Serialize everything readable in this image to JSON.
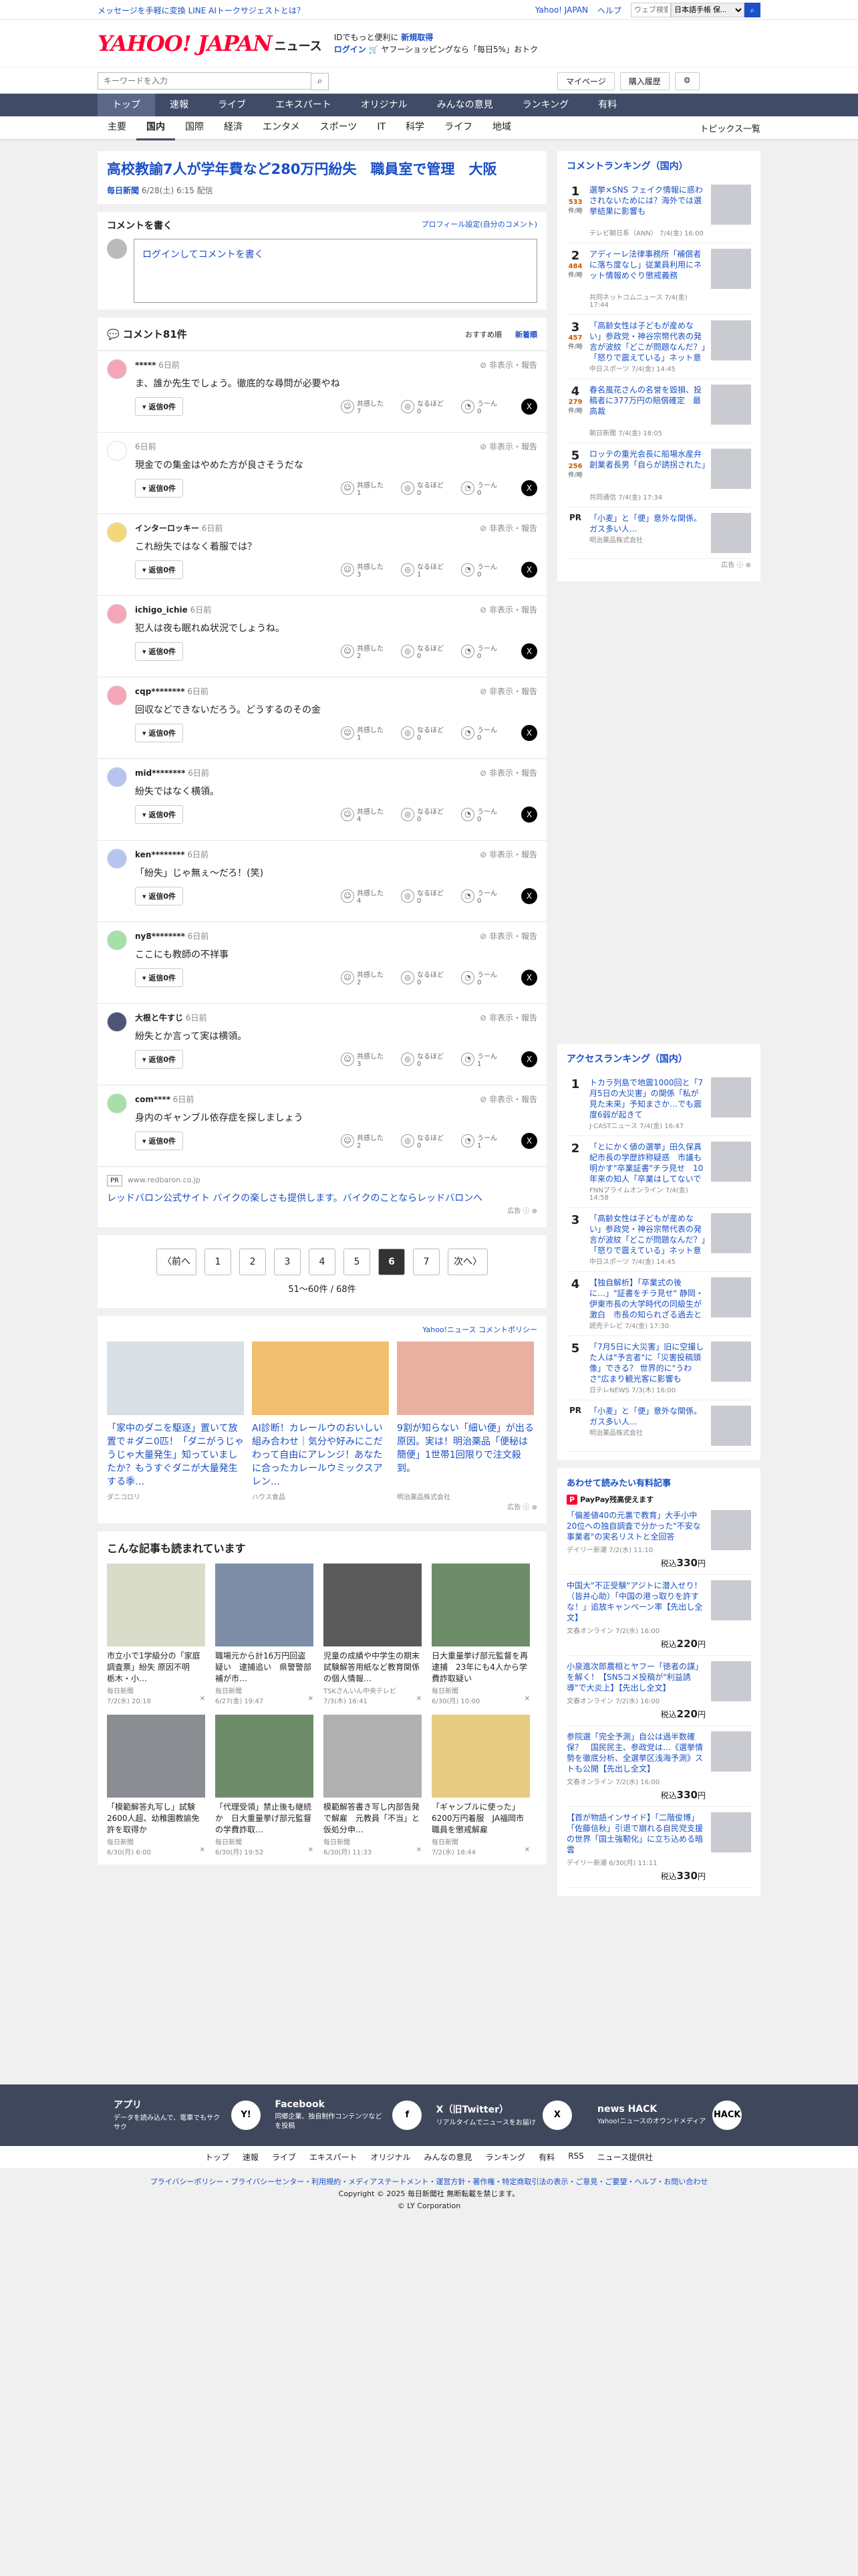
{
  "topbar": {
    "promo": "メッセージを手軽に変換 LINE AIトークサジェストとは？",
    "links": [
      "Yahoo! JAPAN",
      "ヘルプ"
    ],
    "search_placeholder": "ウェブ検索",
    "search_scope": "日本語手帳 保..."
  },
  "header": {
    "logo": "YAHOO! JAPAN",
    "logo_sub": "ニュース",
    "promo_line1": "IDでもっと便利に",
    "promo_new": "新規取得",
    "promo_login": "ログイン",
    "promo_line2": "ヤフーショッピングなら「毎日5%」おトク"
  },
  "search": {
    "placeholder": "キーワードを入力",
    "mypage": "マイページ",
    "purchased": "購入履歴"
  },
  "nav1": [
    "トップ",
    "速報",
    "ライブ",
    "エキスパート",
    "オリジナル",
    "みんなの意見",
    "ランキング",
    "有料"
  ],
  "nav2": [
    "主要",
    "国内",
    "国際",
    "経済",
    "エンタメ",
    "スポーツ",
    "IT",
    "科学",
    "ライフ",
    "地域"
  ],
  "nav2_topics": "トピックス一覧",
  "article": {
    "title": "高校教諭7人が学年費など280万円紛失　職員室で管理　大阪",
    "source": "毎日新聞",
    "date": "6/28(土) 6:15 配信"
  },
  "cwrite": {
    "heading": "コメントを書く",
    "profile": "プロフィール設定(自分のコメント)",
    "placeholder": "ログインしてコメントを書く"
  },
  "comments": {
    "count_label": "コメント81件",
    "sort": [
      "おすすめ順",
      "新着順"
    ],
    "reply": "返信0件",
    "report": "非表示・報告",
    "sympathy": "共感した",
    "hmm": "なるほど",
    "umm": "うーん",
    "items": [
      {
        "name": "*****",
        "time": "6日前",
        "text": "ま、誰か先生でしょう。徹底的な尋問が必要やね",
        "s": "7",
        "n": "0",
        "u": "0",
        "color": "#f4a6b8"
      },
      {
        "name": "",
        "time": "6日前",
        "text": "現金での集金はやめた方が良さそうだな",
        "s": "1",
        "n": "0",
        "u": "0",
        "color": "#ffffff"
      },
      {
        "name": "インターロッキー",
        "time": "6日前",
        "text": "これ紛失ではなく着服では？",
        "s": "3",
        "n": "1",
        "u": "0",
        "color": "#f5d77a"
      },
      {
        "name": "ichigo_ichie",
        "time": "6日前",
        "text": "犯人は夜も眠れぬ状況でしょうね。",
        "s": "2",
        "n": "0",
        "u": "0",
        "color": "#f4a6b8"
      },
      {
        "name": "cqp********",
        "time": "6日前",
        "text": "回収などできないだろう。どうするのその金",
        "s": "1",
        "n": "0",
        "u": "0",
        "color": "#f4a6b8"
      },
      {
        "name": "mid********",
        "time": "6日前",
        "text": "紛失ではなく横領。",
        "s": "4",
        "n": "0",
        "u": "0",
        "color": "#b8c4f0"
      },
      {
        "name": "ken********",
        "time": "6日前",
        "text": "「紛失」じゃ無ぇ〜だろ！(笑)",
        "s": "4",
        "n": "0",
        "u": "0",
        "color": "#b8c4f0"
      },
      {
        "name": "ny8********",
        "time": "6日前",
        "text": "ここにも教師の不祥事",
        "s": "2",
        "n": "0",
        "u": "0",
        "color": "#a6e0a8"
      },
      {
        "name": "大根と牛すじ",
        "time": "6日前",
        "text": "紛失とか言って実は横領。",
        "s": "3",
        "n": "0",
        "u": "1",
        "color": "#4a5577"
      },
      {
        "name": "com****",
        "time": "6日前",
        "text": "身内のギャンブル依存症を探しましょう",
        "s": "2",
        "n": "0",
        "u": "1",
        "color": "#a6e0a8"
      }
    ]
  },
  "ad1": {
    "pr": "PR",
    "url": "www.redbaron.co.jp",
    "title": "レッドバロン公式サイト バイクの楽しさも提供します。バイクのことならレッドバロンへ",
    "mark": "広告"
  },
  "pagination": {
    "prev": "〈前へ",
    "pages": [
      "1",
      "2",
      "3",
      "4",
      "5",
      "6",
      "7"
    ],
    "current": "6",
    "next": "次へ〉",
    "count": "51〜60件 / 68件"
  },
  "promos": {
    "policy": "Yahoo!ニュース コメントポリシー",
    "items": [
      {
        "title": "「家中のダニを駆逐」置いて放置で＃ダニ0匹！「ダニがうじゃうじゃ大量発生」知っていましたか？もうすぐダニが大量発生する季…",
        "src": "ダニコロリ"
      },
      {
        "title": "AI診断！カレールウのおいしい組み合わせ｜気分や好みにこだわって自由にアレンジ！あなたに合ったカレールウミックスアレン…",
        "src": "ハウス食品"
      },
      {
        "title": "9割が知らない「細い便」が出る原因。実は！明治薬品「便秘は簡便」1世帯1回限りで注文殺到。",
        "src": "明治薬品株式会社"
      }
    ],
    "mark": "広告"
  },
  "readtoo": {
    "heading": "こんな記事も読まれています",
    "items": [
      {
        "title": "市立小で1学級分の「家庭調査票」紛失 原因不明　栃木・小…",
        "src": "毎日新聞",
        "date": "7/2(水) 20:18"
      },
      {
        "title": "職場元から計16万円回盗疑い　逮捕追い　県警警部補が市…",
        "src": "毎日新聞",
        "date": "6/27(金) 19:47"
      },
      {
        "title": "児童の成績や中学生の期末試験解答用紙など教育関係の個人情報…",
        "src": "TSKさんいん中央テレビ",
        "date": "7/3(木) 16:41"
      },
      {
        "title": "日大重量挙げ部元監督を再逮捕　23年にも4人から学費詐取疑い",
        "src": "毎日新聞",
        "date": "6/30(月) 10:00"
      },
      {
        "title": "「模範解答丸写し」試験　2600人超、幼稚園教諭免許を取得か",
        "src": "毎日新聞",
        "date": "6/30(月) 6:00"
      },
      {
        "title": "「代理受領」禁止後も継続か　日大重量挙げ部元監督の学費詐取…",
        "src": "毎日新聞",
        "date": "6/30(月) 19:52"
      },
      {
        "title": "模範解答書き写し内部告発で解雇　元教員「不当」と仮処分申…",
        "src": "毎日新聞",
        "date": "6/30(月) 11:33"
      },
      {
        "title": "「ギャンブルに使った」6200万円着服　JA福岡市職員を懲戒解雇",
        "src": "毎日新聞",
        "date": "7/2(水) 18:44"
      }
    ]
  },
  "ranking": {
    "heading": "コメントランキング（国内）",
    "unit": "件/時",
    "items": [
      {
        "rank": "1",
        "count": "533",
        "title": "選挙×SNS フェイク情報に惑わされないためには？海外では選挙結果に影響も",
        "src": "テレビ朝日系（ANN）",
        "date": "7/4(金) 16:00"
      },
      {
        "rank": "2",
        "count": "484",
        "title": "アディーレ法律事務所「補償者に落ち度なし」従業員利用にネット情報めぐり懲戒義務",
        "src": "共同ネットコムニュース",
        "date": "7/4(金) 17:44"
      },
      {
        "rank": "3",
        "count": "457",
        "title": "「高齢女性は子どもが産めない」参政党・神谷宗幣代表の発言が波紋「どこが問題なんだ？」「怒りで震えている」ネット意見",
        "src": "中日スポーツ",
        "date": "7/4(金) 14:45"
      },
      {
        "rank": "4",
        "count": "279",
        "title": "春名風花さんの名誉を毀損、投稿者に377万円の賠償確定　最高裁",
        "src": "朝日新聞",
        "date": "7/4(金) 18:05"
      },
      {
        "rank": "5",
        "count": "256",
        "title": "ロッテの重光会長に船場水産弁　創業者長男「自らが誘拐された」",
        "src": "共同通信",
        "date": "7/4(金) 17:34"
      }
    ],
    "ad": {
      "pr": "PR",
      "title": "「小麦」と「便」意外な関係。ガス多い人...",
      "src": "明治薬品株式会社"
    },
    "mark": "広告"
  },
  "access": {
    "heading": "アクセスランキング（国内）",
    "items": [
      {
        "rank": "1",
        "title": "トカラ列島で地震1000回と「7月5日の大災害」の関係「私が見た未来」予知まさか…でも震度6弱が起きて",
        "src": "J-CASTニュース",
        "date": "7/4(金) 16:47"
      },
      {
        "rank": "2",
        "title": "「とにかく値の選挙」田久保真紀市長の学歴詐称疑惑　市議も明かす\"卒業証書\"チラ見せ　10年来の知人「卒業はしてないでしょうね、と…」",
        "src": "FNNプライムオンライン",
        "date": "7/4(金) 14:58"
      },
      {
        "rank": "3",
        "title": "「高齢女性は子どもが産めない」参政党・神谷宗幣代表の発言が波紋「どこが問題なんだ？」「怒りで震えている」ネット意見",
        "src": "中日スポーツ",
        "date": "7/4(金) 14:45"
      },
      {
        "rank": "4",
        "title": "【独自解析】「卒業式の後に…」\"証書をチラ見せ\" 静岡・伊東市長の大学時代の同級生が激白　市長の知られざる過去とは",
        "src": "読売テレビ",
        "date": "7/4(金) 17:30"
      },
      {
        "rank": "5",
        "title": "「7月5日に大災害」旧に空撮した人は\"予言者\"に「災害投稿頭像」できる？ 世界的に\"うわさ\"広まり観光客に影響も",
        "src": "日テレNEWS",
        "date": "7/3(木) 16:00"
      }
    ],
    "ad": {
      "pr": "PR",
      "title": "「小麦」と「便」意外な関係。ガス多い人...",
      "src": "明治薬品株式会社"
    }
  },
  "paid": {
    "heading": "あわせて読みたい有料記事",
    "paypay": "PayPay残高使えます",
    "items": [
      {
        "title": "「偏差値40の元裏で教育」大手小中20位への独自調査で分かった\"不安な事業者\"の実名リストと全回答",
        "src": "デイリー新潮",
        "date": "7/2(水) 11:10",
        "price": "330"
      },
      {
        "title": "中国大\"不正受験\"アジトに潜入せり！（皆井心助）「中国の港っ取りを許すな！」追放キャンペーン率【先出し全文】",
        "src": "文春オンライン",
        "date": "7/2(水) 16:00",
        "price": "220"
      },
      {
        "title": "小泉進次郎農相とヤフー「徳者の謀」を解く！【SNSコメ投稿が\"利益誘導\"で大炎上】【先出し全文】",
        "src": "文春オンライン",
        "date": "7/2(水) 16:00",
        "price": "220"
      },
      {
        "title": "参院選「完全予測」自公は過半数確保？　国民民主、参政党は…《選挙情勢を徹底分析、全選挙区浅海予測》ストも公開【先出し全文】",
        "src": "文春オンライン",
        "date": "7/2(水) 16:00",
        "price": "330"
      },
      {
        "title": "【首が物語インサイド】「二階俊博」「佐藤信秋」引退で崩れる自民党支援の世界「国土強靭化」に立ち込める暗雲",
        "src": "デイリー新潮",
        "date": "6/30(月) 11:11",
        "price": "330"
      }
    ],
    "tax": "税込",
    "yen": "円"
  },
  "footer": {
    "apps": [
      {
        "t": "アプリ",
        "d": "データを読み込んで、電車でもサクサク",
        "ic": "Y!"
      },
      {
        "t": "Facebook",
        "d": "同郷企業、独自制作コンテンツなどを投稿",
        "ic": "f"
      },
      {
        "t": "X（旧Twitter）",
        "d": "リアルタイムでニュースをお届け",
        "ic": "X"
      },
      {
        "t": "news HACK",
        "d": "Yahoo!ニュースのオウンドメディア",
        "ic": "HACK"
      }
    ],
    "links": [
      "トップ",
      "速報",
      "ライブ",
      "エキスパート",
      "オリジナル",
      "みんなの意見",
      "ランキング",
      "有料",
      "RSS",
      "ニュース提供社"
    ],
    "legal": "プライバシーポリシー・プライバシーセンター・利用規約・メディアステートメント・運営方針・著作権・特定商取引法の表示・ご意見・ご要望・ヘルプ・お問い合わせ",
    "copyright": "Copyright © 2025 毎日新聞社 無断転載を禁じます。",
    "corp": "© LY Corporation"
  }
}
